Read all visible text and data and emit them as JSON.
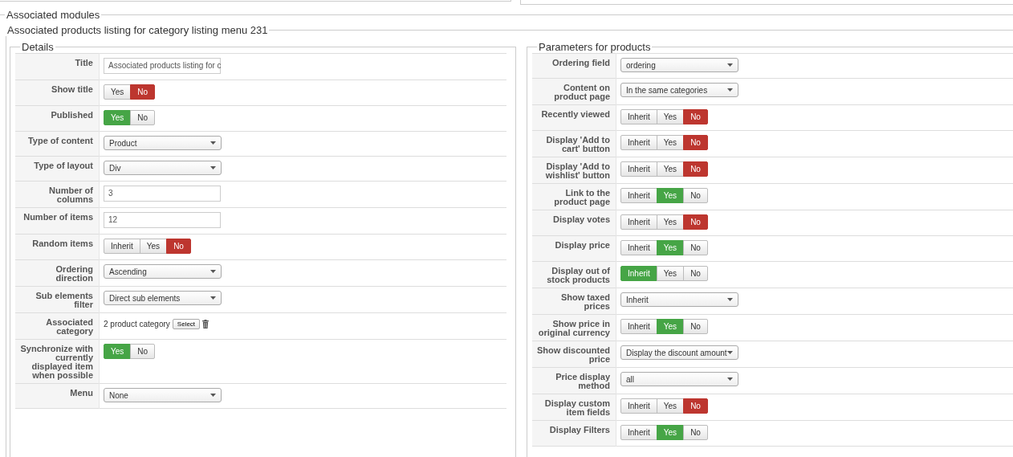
{
  "modules_title": "Associated modules",
  "listing_title": "Associated products listing for category listing menu 231",
  "details": {
    "title": "Details",
    "rows": [
      {
        "label": "Title",
        "kind": "text",
        "value": "Associated products listing for c"
      },
      {
        "label": "Show title",
        "kind": "toggle",
        "options": [
          {
            "label": "Yes",
            "selected": false
          },
          {
            "label": "No",
            "selected": true,
            "color": "#bd362f"
          }
        ]
      },
      {
        "label": "Published",
        "kind": "toggle",
        "options": [
          {
            "label": "Yes",
            "selected": true,
            "color": "#46a546"
          },
          {
            "label": "No",
            "selected": false
          }
        ]
      },
      {
        "label": "Type of content",
        "kind": "select",
        "value": "Product"
      },
      {
        "label": "Type of layout",
        "kind": "select",
        "value": "Div"
      },
      {
        "label": "Number of columns",
        "kind": "text",
        "value": "3"
      },
      {
        "label": "Number of items",
        "kind": "text",
        "value": "12"
      },
      {
        "label": "Random items",
        "kind": "toggle",
        "options": [
          {
            "label": "Inherit",
            "selected": false
          },
          {
            "label": "Yes",
            "selected": false
          },
          {
            "label": "No",
            "selected": true,
            "color": "#bd362f"
          }
        ]
      },
      {
        "label": "Ordering direction",
        "kind": "select",
        "value": "Ascending"
      },
      {
        "label": "Sub elements filter",
        "kind": "select",
        "value": "Direct sub elements"
      },
      {
        "label": "Associated category",
        "kind": "category",
        "value": "2 product category",
        "button": "Select"
      },
      {
        "label": "Synchronize with currently displayed item when possible",
        "kind": "toggle",
        "options": [
          {
            "label": "Yes",
            "selected": true,
            "color": "#46a546"
          },
          {
            "label": "No",
            "selected": false
          }
        ]
      },
      {
        "label": "Menu",
        "kind": "select",
        "value": "None"
      }
    ]
  },
  "parameters": {
    "title": "Parameters for products",
    "rows": [
      {
        "label": "Ordering field",
        "kind": "select",
        "value": "ordering"
      },
      {
        "label": "Content on product page",
        "kind": "select",
        "value": "In the same categories"
      },
      {
        "label": "Recently viewed",
        "kind": "toggle",
        "options": [
          {
            "label": "Inherit",
            "selected": false
          },
          {
            "label": "Yes",
            "selected": false
          },
          {
            "label": "No",
            "selected": true,
            "color": "#bd362f"
          }
        ]
      },
      {
        "label": "Display 'Add to cart' button",
        "kind": "toggle",
        "options": [
          {
            "label": "Inherit",
            "selected": false
          },
          {
            "label": "Yes",
            "selected": false
          },
          {
            "label": "No",
            "selected": true,
            "color": "#bd362f"
          }
        ]
      },
      {
        "label": "Display 'Add to wishlist' button",
        "kind": "toggle",
        "options": [
          {
            "label": "Inherit",
            "selected": false
          },
          {
            "label": "Yes",
            "selected": false
          },
          {
            "label": "No",
            "selected": true,
            "color": "#bd362f"
          }
        ]
      },
      {
        "label": "Link to the product page",
        "kind": "toggle",
        "options": [
          {
            "label": "Inherit",
            "selected": false
          },
          {
            "label": "Yes",
            "selected": true,
            "color": "#46a546"
          },
          {
            "label": "No",
            "selected": false
          }
        ]
      },
      {
        "label": "Display votes",
        "kind": "toggle",
        "options": [
          {
            "label": "Inherit",
            "selected": false
          },
          {
            "label": "Yes",
            "selected": false
          },
          {
            "label": "No",
            "selected": true,
            "color": "#bd362f"
          }
        ]
      },
      {
        "label": "Display price",
        "kind": "toggle",
        "options": [
          {
            "label": "Inherit",
            "selected": false
          },
          {
            "label": "Yes",
            "selected": true,
            "color": "#46a546"
          },
          {
            "label": "No",
            "selected": false
          }
        ]
      },
      {
        "label": "Display out of stock products",
        "kind": "toggle",
        "options": [
          {
            "label": "Inherit",
            "selected": true,
            "color": "#46a546"
          },
          {
            "label": "Yes",
            "selected": false
          },
          {
            "label": "No",
            "selected": false
          }
        ]
      },
      {
        "label": "Show taxed prices",
        "kind": "select",
        "value": "Inherit"
      },
      {
        "label": "Show price in original currency",
        "kind": "toggle",
        "options": [
          {
            "label": "Inherit",
            "selected": false
          },
          {
            "label": "Yes",
            "selected": true,
            "color": "#46a546"
          },
          {
            "label": "No",
            "selected": false
          }
        ]
      },
      {
        "label": "Show discounted price",
        "kind": "select",
        "value": "Display the discount amount"
      },
      {
        "label": "Price display method",
        "kind": "select",
        "value": "all"
      },
      {
        "label": "Display custom item fields",
        "kind": "toggle",
        "options": [
          {
            "label": "Inherit",
            "selected": false
          },
          {
            "label": "Yes",
            "selected": false
          },
          {
            "label": "No",
            "selected": true,
            "color": "#bd362f"
          }
        ]
      },
      {
        "label": "Display Filters",
        "kind": "toggle",
        "options": [
          {
            "label": "Inherit",
            "selected": false
          },
          {
            "label": "Yes",
            "selected": true,
            "color": "#46a546"
          },
          {
            "label": "No",
            "selected": false
          }
        ]
      }
    ]
  }
}
